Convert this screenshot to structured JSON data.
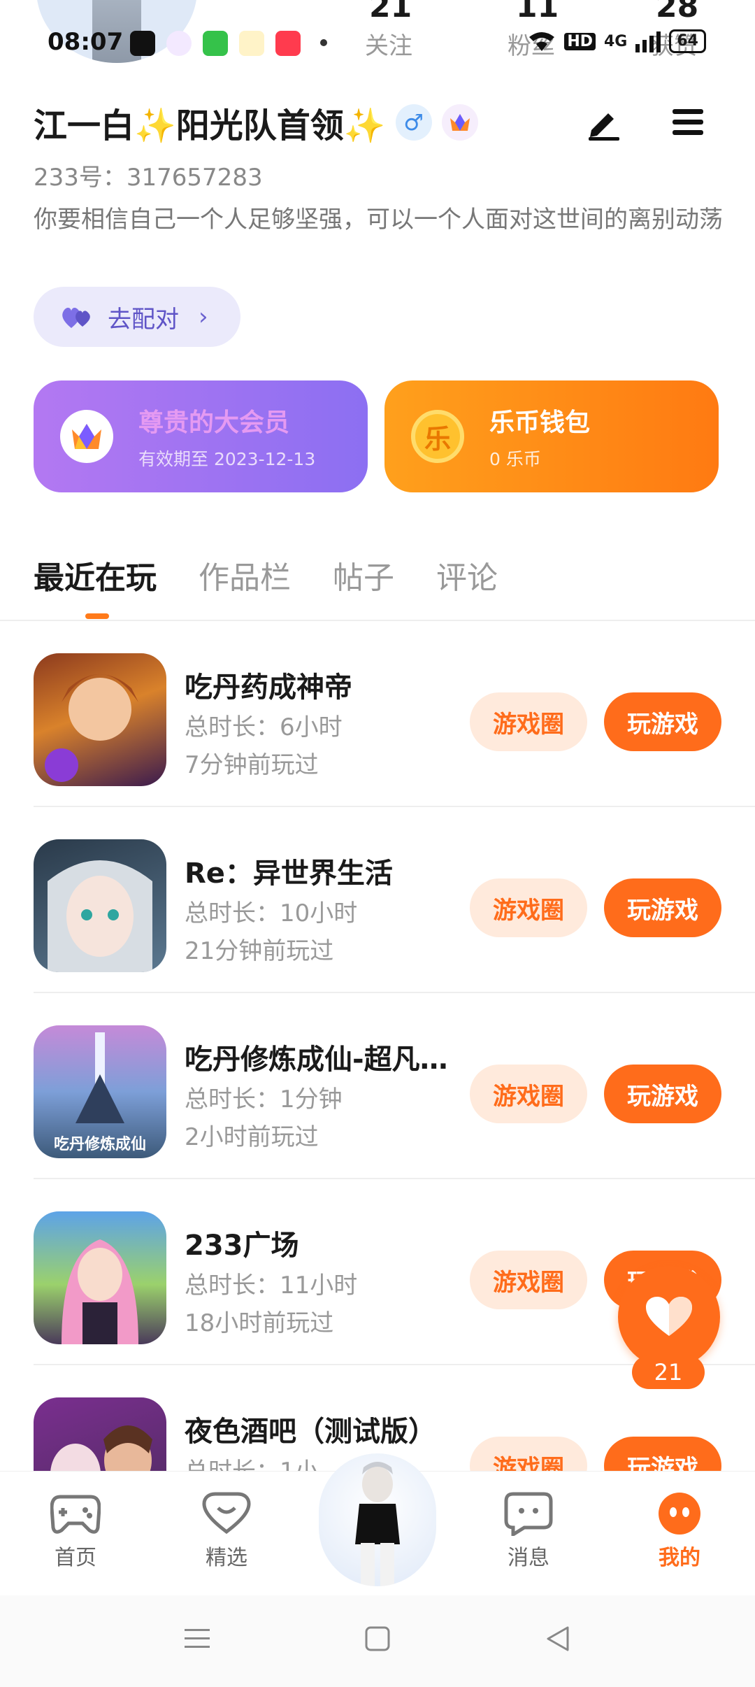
{
  "status_bar": {
    "time": "08:07",
    "battery": "64",
    "network": "4G"
  },
  "header": {
    "follow_count": "21",
    "follow_label": "关注",
    "fans_count": "11",
    "fans_label": "粉丝",
    "likes_count": "28",
    "likes_label": "获赞"
  },
  "profile": {
    "name": "江一白✨阳光队首领✨",
    "gender_symbol": "♂",
    "id_text": "233号：317657283",
    "bio": "你要相信自己一个人足够坚强，可以一个人面对这世间的离别动荡",
    "pair_label": "去配对"
  },
  "cards": {
    "vip_title": "尊贵的大会员",
    "vip_sub": "有效期至 2023-12-13",
    "wallet_icon": "乐",
    "wallet_title": "乐币钱包",
    "wallet_sub": "0 乐币"
  },
  "tabs": [
    "最近在玩",
    "作品栏",
    "帖子",
    "评论"
  ],
  "games": [
    {
      "title": "吃丹药成神帝",
      "duration": "总时长：6小时",
      "last_played": "7分钟前玩过",
      "icon_caption": ""
    },
    {
      "title": "Re：异世界生活",
      "duration": "总时长：10小时",
      "last_played": "21分钟前玩过",
      "icon_caption": ""
    },
    {
      "title": "吃丹修炼成仙-超凡…",
      "duration": "总时长：1分钟",
      "last_played": "2小时前玩过",
      "icon_caption": "吃丹修炼成仙"
    },
    {
      "title": "233广场",
      "duration": "总时长：11小时",
      "last_played": "18小时前玩过",
      "icon_caption": ""
    },
    {
      "title": "夜色酒吧（测试版）",
      "duration": "总时长：1小",
      "last_played": "",
      "icon_caption": ""
    }
  ],
  "game_buttons": {
    "circle_label": "游戏圈",
    "play_label": "玩游戏"
  },
  "float_like": {
    "count": "21"
  },
  "bottom_nav": {
    "home": "首页",
    "featured": "精选",
    "messages": "消息",
    "mine": "我的"
  },
  "colors": {
    "accent": "#ff6c1b",
    "vip": "#8c6ff2",
    "wallet": "#ff8a14"
  }
}
